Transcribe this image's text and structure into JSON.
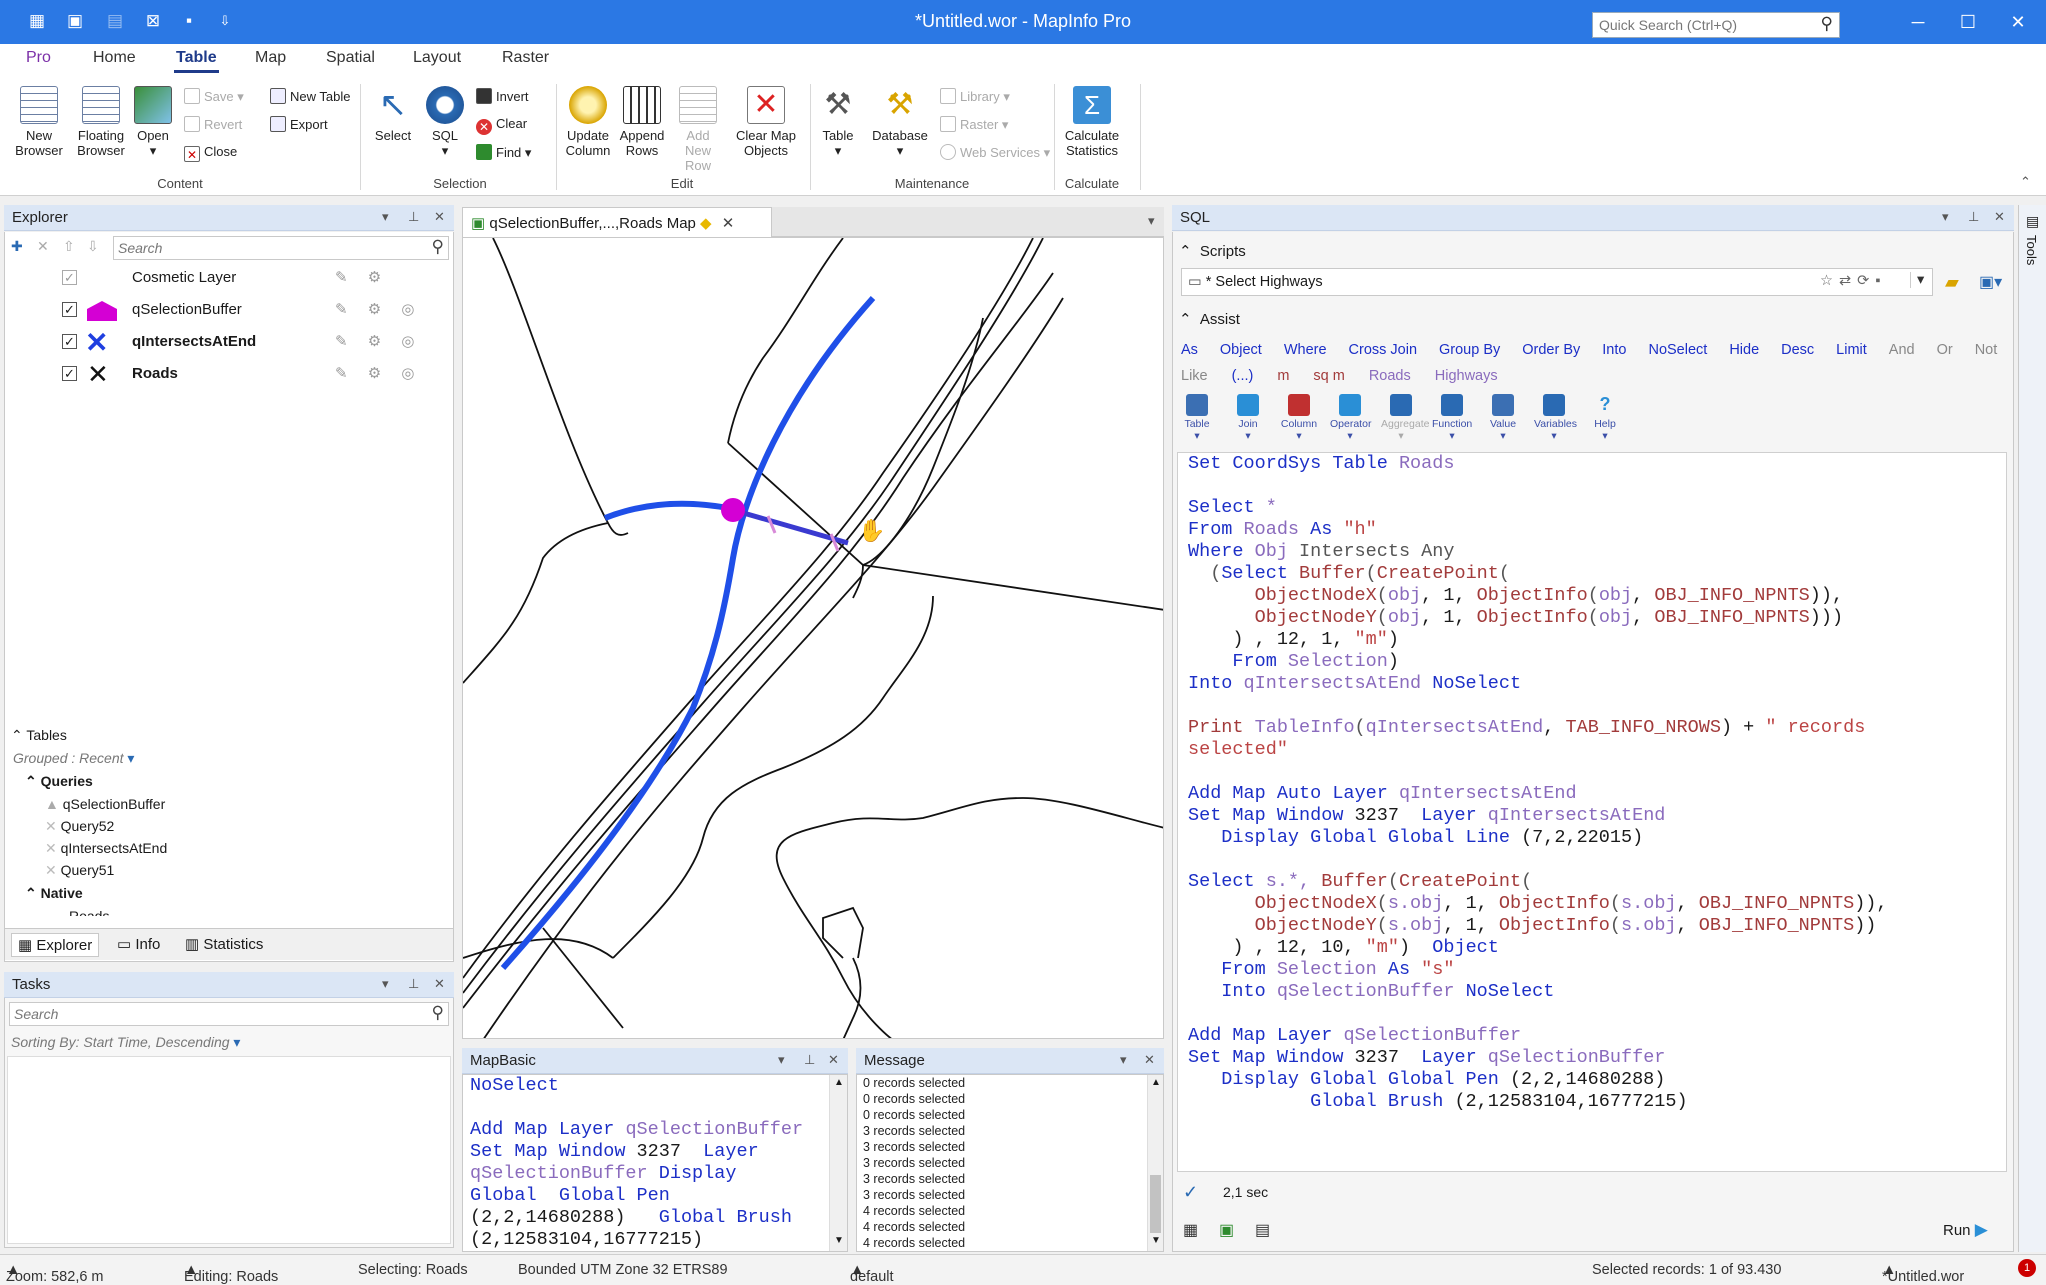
{
  "window": {
    "title": "*Untitled.wor - MapInfo Pro",
    "quick_search_placeholder": "Quick Search (Ctrl+Q)",
    "minimize": "─",
    "maximize": "☐",
    "close": "✕"
  },
  "ribbon_tabs": [
    "Pro",
    "Home",
    "Table",
    "Map",
    "Spatial",
    "Layout",
    "Raster"
  ],
  "ribbon": {
    "new_browser": "New Browser",
    "floating_browser": "Floating Browser",
    "open": "Open",
    "save": "Save",
    "revert": "Revert",
    "close": "Close",
    "new_table": "New Table",
    "export": "Export",
    "content_group": "Content",
    "select": "Select",
    "sql": "SQL",
    "invert": "Invert",
    "clear": "Clear",
    "find": "Find",
    "selection_group": "Selection",
    "update_column": "Update Column",
    "append_rows": "Append Rows",
    "add_new_row": "Add New Row",
    "clear_map_objects": "Clear Map Objects",
    "edit_group": "Edit",
    "table": "Table",
    "database": "Database",
    "library": "Library",
    "raster": "Raster",
    "web_services": "Web Services",
    "maintenance_group": "Maintenance",
    "calculate_statistics": "Calculate Statistics",
    "calculate_group": "Calculate"
  },
  "explorer": {
    "title": "Explorer",
    "search_placeholder": "Search",
    "layers": [
      {
        "name": "Cosmetic Layer",
        "bold": false
      },
      {
        "name": "qSelectionBuffer",
        "bold": false
      },
      {
        "name": "qIntersectsAtEnd",
        "bold": true
      },
      {
        "name": "Roads",
        "bold": true
      }
    ],
    "tables_header": "Tables",
    "grouped": "Grouped : Recent",
    "queries_header": "Queries",
    "queries": [
      "qSelectionBuffer",
      "Query52",
      "qIntersectsAtEnd",
      "Query51"
    ],
    "native_header": "Native",
    "native_partial": "Roads",
    "bottom_tabs": [
      "Explorer",
      "Info",
      "Statistics"
    ]
  },
  "tasks": {
    "title": "Tasks",
    "search_placeholder": "Search",
    "sorting": "Sorting By: Start Time, Descending"
  },
  "map": {
    "tab_title": "qSelectionBuffer,...,Roads Map"
  },
  "mapbasic": {
    "title": "MapBasic",
    "lines": [
      [
        [
          "NoSelect",
          "kw"
        ]
      ],
      [],
      [
        [
          "Add Map Layer ",
          "kw"
        ],
        [
          "qSelectionBuffer",
          "tb"
        ]
      ],
      [
        [
          "Set Map Window ",
          "kw"
        ],
        [
          "3237  ",
          ""
        ],
        [
          "Layer",
          "kw"
        ]
      ],
      [
        [
          "qSelectionBuffer ",
          "tb"
        ],
        [
          "Display",
          "kw"
        ]
      ],
      [
        [
          "Global  Global Pen",
          "kw"
        ]
      ],
      [
        [
          "(2,2,14680288)   ",
          ""
        ],
        [
          "Global Brush",
          "kw"
        ]
      ],
      [
        [
          "(2,12583104,16777215)",
          ""
        ]
      ]
    ]
  },
  "message": {
    "title": "Message",
    "lines": [
      "0 records selected",
      "0 records selected",
      "0 records selected",
      "3 records selected",
      "3 records selected",
      "3 records selected",
      "3 records selected",
      "3 records selected",
      "4 records selected",
      "4 records selected",
      "4 records selected",
      "4 records selected"
    ]
  },
  "sql": {
    "title": "SQL",
    "scripts_header": "Scripts",
    "script_name": "* Select Highways",
    "assist_header": "Assist",
    "assist_row1": [
      {
        "t": "As",
        "c": ""
      },
      {
        "t": "Object",
        "c": ""
      },
      {
        "t": "Where",
        "c": ""
      },
      {
        "t": "Cross Join",
        "c": ""
      },
      {
        "t": "Group By",
        "c": ""
      },
      {
        "t": "Order By",
        "c": ""
      },
      {
        "t": "Into",
        "c": ""
      },
      {
        "t": "NoSelect",
        "c": ""
      },
      {
        "t": "Hide",
        "c": ""
      },
      {
        "t": "Desc",
        "c": ""
      },
      {
        "t": "Limit",
        "c": ""
      },
      {
        "t": "And",
        "c": "g"
      },
      {
        "t": "Or",
        "c": "g"
      },
      {
        "t": "Not",
        "c": "g"
      }
    ],
    "assist_row2": [
      {
        "t": "Like",
        "c": "g"
      },
      {
        "t": "(...)",
        "c": ""
      },
      {
        "t": "m",
        "c": "m"
      },
      {
        "t": "sq m",
        "c": "m"
      },
      {
        "t": "Roads",
        "c": "p"
      },
      {
        "t": "Highways",
        "c": "p"
      }
    ],
    "assist_tools": [
      "Table",
      "Join",
      "Column",
      "Operator",
      "Aggregate",
      "Function",
      "Value",
      "Variables",
      "Help"
    ],
    "code": [
      [
        [
          "Set CoordSys Table ",
          "kw"
        ],
        [
          "Roads",
          "tb"
        ]
      ],
      [],
      [
        [
          "Select ",
          "kw"
        ],
        [
          "*",
          "tb"
        ]
      ],
      [
        [
          "From ",
          "kw"
        ],
        [
          "Roads ",
          "tb"
        ],
        [
          "As ",
          "kw"
        ],
        [
          "\"h\"",
          "st"
        ]
      ],
      [
        [
          "Where ",
          "kw"
        ],
        [
          "Obj ",
          "tb"
        ],
        [
          "Intersects Any",
          "gy"
        ]
      ],
      [
        [
          "  (",
          "gy"
        ],
        [
          "Select ",
          "kw"
        ],
        [
          "Buffer",
          "fn"
        ],
        [
          "(",
          "gy"
        ],
        [
          "CreatePoint",
          "fn"
        ],
        [
          "(",
          "gy"
        ]
      ],
      [
        [
          "      ObjectNodeX",
          "fn"
        ],
        [
          "(",
          "gy"
        ],
        [
          "obj",
          "tb"
        ],
        [
          ", 1, ",
          ""
        ],
        [
          "ObjectInfo",
          "fn"
        ],
        [
          "(",
          "gy"
        ],
        [
          "obj",
          "tb"
        ],
        [
          ", ",
          ""
        ],
        [
          "OBJ_INFO_NPNTS",
          "fn"
        ],
        [
          ")),",
          ""
        ]
      ],
      [
        [
          "      ObjectNodeY",
          "fn"
        ],
        [
          "(",
          "gy"
        ],
        [
          "obj",
          "tb"
        ],
        [
          ", 1, ",
          ""
        ],
        [
          "ObjectInfo",
          "fn"
        ],
        [
          "(",
          "gy"
        ],
        [
          "obj",
          "tb"
        ],
        [
          ", ",
          ""
        ],
        [
          "OBJ_INFO_NPNTS",
          "fn"
        ],
        [
          ")))",
          ""
        ]
      ],
      [
        [
          "    ) , 12, 1, ",
          ""
        ],
        [
          "\"m\"",
          "st"
        ],
        [
          ")",
          ""
        ]
      ],
      [
        [
          "    From ",
          "kw"
        ],
        [
          "Selection",
          "tb"
        ],
        [
          ")",
          ""
        ]
      ],
      [
        [
          "Into ",
          "kw"
        ],
        [
          "qIntersectsAtEnd ",
          "tb"
        ],
        [
          "NoSelect",
          "kw"
        ]
      ],
      [],
      [
        [
          "Print ",
          "fn"
        ],
        [
          "TableInfo",
          "tb"
        ],
        [
          "(",
          "gy"
        ],
        [
          "qIntersectsAtEnd",
          "tb"
        ],
        [
          ", ",
          ""
        ],
        [
          "TAB_INFO_NROWS",
          "fn"
        ],
        [
          ") + ",
          ""
        ],
        [
          "\" records",
          "st"
        ]
      ],
      [
        [
          "selected\"",
          "st"
        ]
      ],
      [],
      [
        [
          "Add Map Auto Layer ",
          "kw"
        ],
        [
          "qIntersectsAtEnd",
          "tb"
        ]
      ],
      [
        [
          "Set Map Window ",
          "kw"
        ],
        [
          "3237  ",
          ""
        ],
        [
          "Layer ",
          "kw"
        ],
        [
          "qIntersectsAtEnd",
          "tb"
        ]
      ],
      [
        [
          "   Display Global Global Line ",
          "kw"
        ],
        [
          "(7,2,22015)",
          ""
        ]
      ],
      [],
      [
        [
          "Select ",
          "kw"
        ],
        [
          "s.*, ",
          "tb"
        ],
        [
          "Buffer",
          "fn"
        ],
        [
          "(",
          "gy"
        ],
        [
          "CreatePoint",
          "fn"
        ],
        [
          "(",
          "gy"
        ]
      ],
      [
        [
          "      ObjectNodeX",
          "fn"
        ],
        [
          "(",
          "gy"
        ],
        [
          "s.obj",
          "tb"
        ],
        [
          ", 1, ",
          ""
        ],
        [
          "ObjectInfo",
          "fn"
        ],
        [
          "(",
          "gy"
        ],
        [
          "s.obj",
          "tb"
        ],
        [
          ", ",
          ""
        ],
        [
          "OBJ_INFO_NPNTS",
          "fn"
        ],
        [
          ")),",
          ""
        ]
      ],
      [
        [
          "      ObjectNodeY",
          "fn"
        ],
        [
          "(",
          "gy"
        ],
        [
          "s.obj",
          "tb"
        ],
        [
          ", 1, ",
          ""
        ],
        [
          "ObjectInfo",
          "fn"
        ],
        [
          "(",
          "gy"
        ],
        [
          "s.obj",
          "tb"
        ],
        [
          ", ",
          ""
        ],
        [
          "OBJ_INFO_NPNTS",
          "fn"
        ],
        [
          "))",
          ""
        ]
      ],
      [
        [
          "    ) , 12, 10, ",
          ""
        ],
        [
          "\"m\"",
          "st"
        ],
        [
          ")  ",
          ""
        ],
        [
          "Object",
          "kw"
        ]
      ],
      [
        [
          "   From ",
          "kw"
        ],
        [
          "Selection ",
          "tb"
        ],
        [
          "As ",
          "kw"
        ],
        [
          "\"s\"",
          "st"
        ]
      ],
      [
        [
          "   Into ",
          "kw"
        ],
        [
          "qSelectionBuffer ",
          "tb"
        ],
        [
          "NoSelect",
          "kw"
        ]
      ],
      [],
      [
        [
          "Add Map Layer ",
          "kw"
        ],
        [
          "qSelectionBuffer",
          "tb"
        ]
      ],
      [
        [
          "Set Map Window ",
          "kw"
        ],
        [
          "3237  ",
          ""
        ],
        [
          "Layer ",
          "kw"
        ],
        [
          "qSelectionBuffer",
          "tb"
        ]
      ],
      [
        [
          "   Display Global Global Pen ",
          "kw"
        ],
        [
          "(2,2,14680288)",
          ""
        ]
      ],
      [
        [
          "           Global Brush ",
          "kw"
        ],
        [
          "(2,12583104,16777215)",
          ""
        ]
      ]
    ],
    "exec_time": "2,1 sec",
    "run": "Run"
  },
  "tools_sidebar": "Tools",
  "status": {
    "zoom": "Zoom: 582,6 m",
    "editing": "Editing: Roads",
    "selecting": "Selecting: Roads",
    "projection": "Bounded UTM Zone 32 ETRS89",
    "style": "default",
    "selected": "Selected records: 1 of 93.430",
    "workspace": "*Untitled.wor",
    "notifications": "1"
  }
}
